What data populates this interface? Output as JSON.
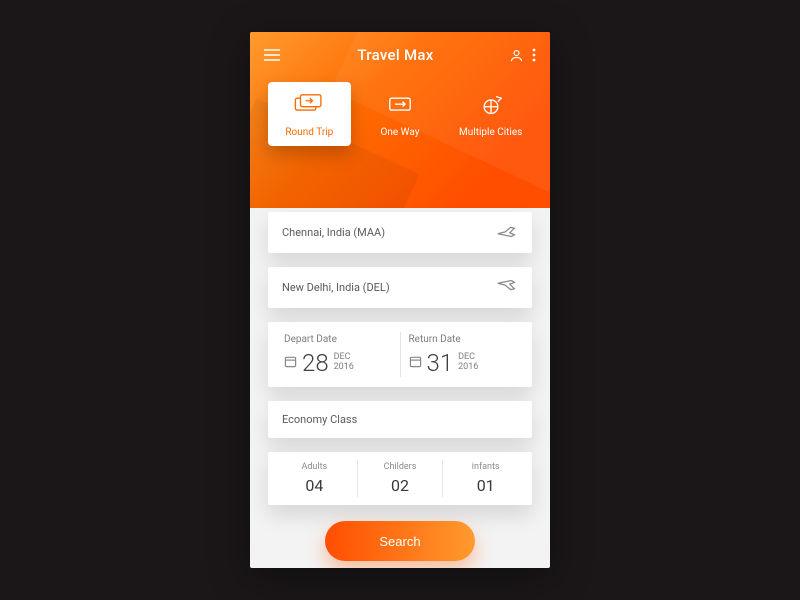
{
  "app": {
    "title": "Travel Max"
  },
  "tripTabs": {
    "roundTrip": "Round Trip",
    "oneWay": "One Way",
    "multiCity": "Multiple Cities",
    "activeIndex": 0
  },
  "route": {
    "from": "Chennai, India (MAA)",
    "to": "New Delhi, India (DEL)"
  },
  "dates": {
    "depart": {
      "label": "Depart Date",
      "day": "28",
      "month": "DEC",
      "year": "2016"
    },
    "return": {
      "label": "Return Date",
      "day": "31",
      "month": "DEC",
      "year": "2016"
    }
  },
  "cabin": {
    "label": "Economy Class"
  },
  "pax": {
    "adults": {
      "label": "Adults",
      "value": "04"
    },
    "children": {
      "label": "Childers",
      "value": "02"
    },
    "infants": {
      "label": "infants",
      "value": "01"
    }
  },
  "actions": {
    "search": "Search"
  },
  "colors": {
    "accentStart": "#ff4e00",
    "accentEnd": "#ff9a2e"
  }
}
